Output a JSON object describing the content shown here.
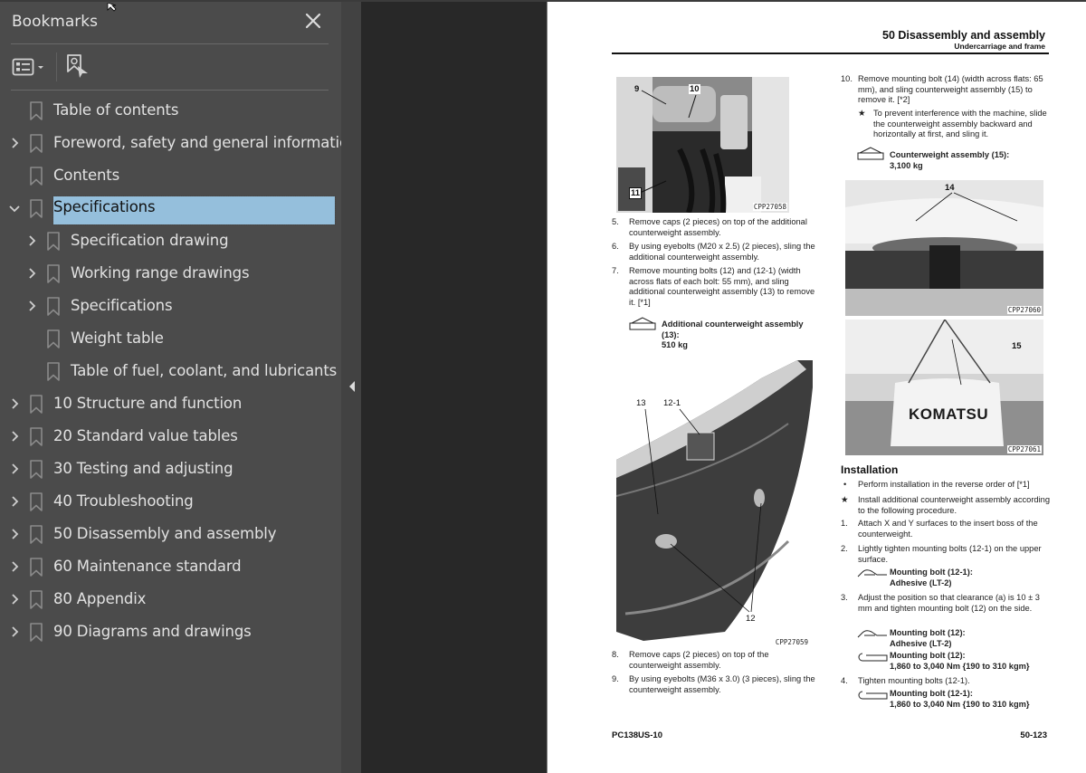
{
  "sidebar": {
    "title": "Bookmarks",
    "close_icon": "close-icon",
    "toolbar": {
      "options_icon": "bookmark-options-icon",
      "find_icon": "find-current-bookmark-icon"
    },
    "items": [
      {
        "label": "Table of contents",
        "level": 0,
        "expandable": false,
        "expanded": false,
        "selected": false
      },
      {
        "label": "Foreword, safety and general information",
        "level": 0,
        "expandable": true,
        "expanded": false,
        "selected": false
      },
      {
        "label": "Contents",
        "level": 0,
        "expandable": false,
        "expanded": false,
        "selected": false
      },
      {
        "label": "Specifications",
        "level": 0,
        "expandable": true,
        "expanded": true,
        "selected": true
      },
      {
        "label": "Specification drawing",
        "level": 1,
        "expandable": true,
        "expanded": false,
        "selected": false
      },
      {
        "label": "Working range drawings",
        "level": 1,
        "expandable": true,
        "expanded": false,
        "selected": false
      },
      {
        "label": "Specifications",
        "level": 1,
        "expandable": true,
        "expanded": false,
        "selected": false
      },
      {
        "label": "Weight table",
        "level": 1,
        "expandable": false,
        "expanded": false,
        "selected": false
      },
      {
        "label": "Table of fuel, coolant, and lubricants",
        "level": 1,
        "expandable": false,
        "expanded": false,
        "selected": false
      },
      {
        "label": "10 Structure and function",
        "level": 0,
        "expandable": true,
        "expanded": false,
        "selected": false
      },
      {
        "label": "20 Standard value tables",
        "level": 0,
        "expandable": true,
        "expanded": false,
        "selected": false
      },
      {
        "label": "30 Testing and adjusting",
        "level": 0,
        "expandable": true,
        "expanded": false,
        "selected": false
      },
      {
        "label": "40 Troubleshooting",
        "level": 0,
        "expandable": true,
        "expanded": false,
        "selected": false
      },
      {
        "label": "50 Disassembly and assembly",
        "level": 0,
        "expandable": true,
        "expanded": false,
        "selected": false
      },
      {
        "label": "60 Maintenance standard",
        "level": 0,
        "expandable": true,
        "expanded": false,
        "selected": false
      },
      {
        "label": "80 Appendix",
        "level": 0,
        "expandable": true,
        "expanded": false,
        "selected": false
      },
      {
        "label": "90 Diagrams and drawings",
        "level": 0,
        "expandable": true,
        "expanded": false,
        "selected": false
      }
    ]
  },
  "colors": {
    "sidebar_bg": "#4b4b4b",
    "viewer_bg": "#282828",
    "selection": "#95bfdc",
    "page_bg": "#ffffff"
  },
  "page": {
    "header_title": "50 Disassembly and assembly",
    "header_subtitle": "Undercarriage and frame",
    "footer_model": "PC138US-10",
    "footer_page": "50-123",
    "figures": [
      {
        "code": "CPP27058",
        "callouts": [
          "9",
          "10",
          "11"
        ]
      },
      {
        "code": "CPP27059",
        "callouts": [
          "13",
          "12-1",
          "12"
        ]
      },
      {
        "code": "CPP27060",
        "callouts": [
          "14"
        ]
      },
      {
        "code": "CPP27061",
        "callouts": [
          "15"
        ],
        "brand_text": "KOMATSU"
      }
    ],
    "left_steps": [
      {
        "num": "5.",
        "text": "Remove caps (2 pieces) on top of the additional counterweight assembly."
      },
      {
        "num": "6.",
        "text": "By using eyebolts (M20 x 2.5) (2 pieces), sling the additional counterweight assembly."
      },
      {
        "num": "7.",
        "text": "Remove mounting bolts (12) and (12-1) (width across flats of each bolt: 55 mm), and sling additional counterweight assembly (13) to remove it. [*1]"
      }
    ],
    "weight_13": {
      "name": "Additional counterweight assembly (13):",
      "value": "510 kg"
    },
    "left_steps2": [
      {
        "num": "8.",
        "text": "Remove caps (2 pieces) on top of the counterweight assembly."
      },
      {
        "num": "9.",
        "text": "By using eyebolts (M36 x 3.0) (3 pieces), sling the counterweight assembly."
      }
    ],
    "step10": {
      "num": "10.",
      "text": "Remove mounting bolt (14) (width across flats: 65 mm), and sling counterweight assembly (15) to remove it. [*2]"
    },
    "step10_note": {
      "mark": "★",
      "text": "To prevent interference with the machine, slide the counterweight assembly backward and horizontally at first, and sling it."
    },
    "weight_15": {
      "name": "Counterweight assembly (15):",
      "value": "3,100 kg"
    },
    "installation": {
      "heading": "Installation",
      "bullet": {
        "mark": "•",
        "text": "Perform installation in the reverse order of [*1]"
      },
      "note": {
        "mark": "★",
        "text": "Install additional counterweight assembly according to the following procedure."
      },
      "steps": [
        {
          "num": "1.",
          "text": "Attach X and Y surfaces to the insert boss of the counterweight."
        },
        {
          "num": "2.",
          "text": "Lightly tighten mounting bolts (12-1) on the upper surface."
        },
        {
          "num": "3.",
          "text": "Adjust the position so that clearance (a) is 10 ± 3 mm and tighten mounting bolt (12) on the side."
        },
        {
          "num": "4.",
          "text": "Tighten mounting bolts (12-1)."
        }
      ],
      "spec_2_adhesive": {
        "name": "Mounting bolt (12-1):",
        "value": "Adhesive (LT-2)"
      },
      "spec_3_adhesive": {
        "name": "Mounting bolt (12):",
        "value": "Adhesive (LT-2)"
      },
      "spec_3_torque": {
        "name": "Mounting bolt (12):",
        "value": "1,860 to 3,040 Nm {190 to 310 kgm}"
      },
      "spec_4_torque": {
        "name": "Mounting bolt (12-1):",
        "value": "1,860 to 3,040 Nm {190 to 310 kgm}"
      }
    }
  }
}
